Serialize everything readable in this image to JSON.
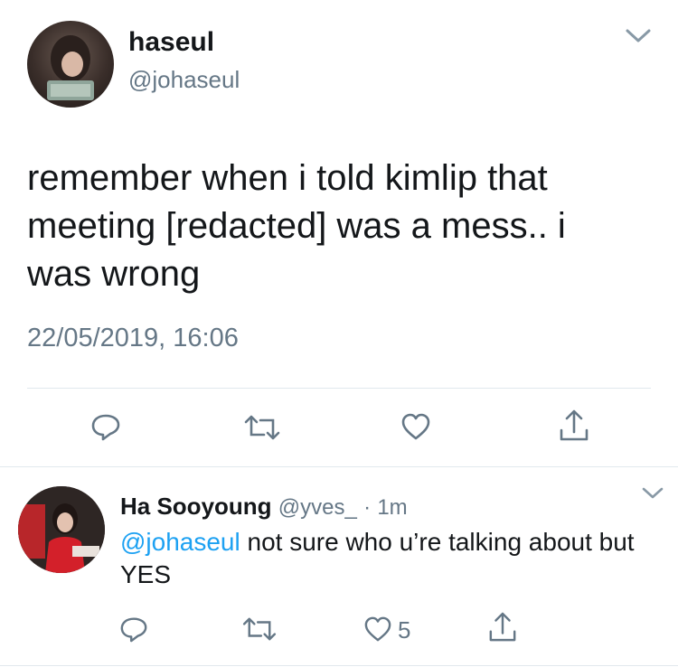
{
  "main_tweet": {
    "display_name": "haseul",
    "handle": "@johaseul",
    "text": "remember when i told kimlip that meeting [redacted] was a mess.. i was wrong",
    "timestamp": "22/05/2019, 16:06",
    "actions": {
      "reply_icon": "reply-icon",
      "retweet_icon": "retweet-icon",
      "like_icon": "heart-icon",
      "share_icon": "share-icon"
    }
  },
  "reply_tweet": {
    "display_name": "Ha Sooyoung",
    "handle": "@yves_",
    "separator": "·",
    "time_ago": "1m",
    "mention": "@johaseul",
    "text": " not sure who u’re talking about but YES",
    "like_count": "5"
  },
  "colors": {
    "text": "#14171a",
    "muted": "#657786",
    "link": "#1da1f2",
    "divider": "#e1e8ed"
  }
}
